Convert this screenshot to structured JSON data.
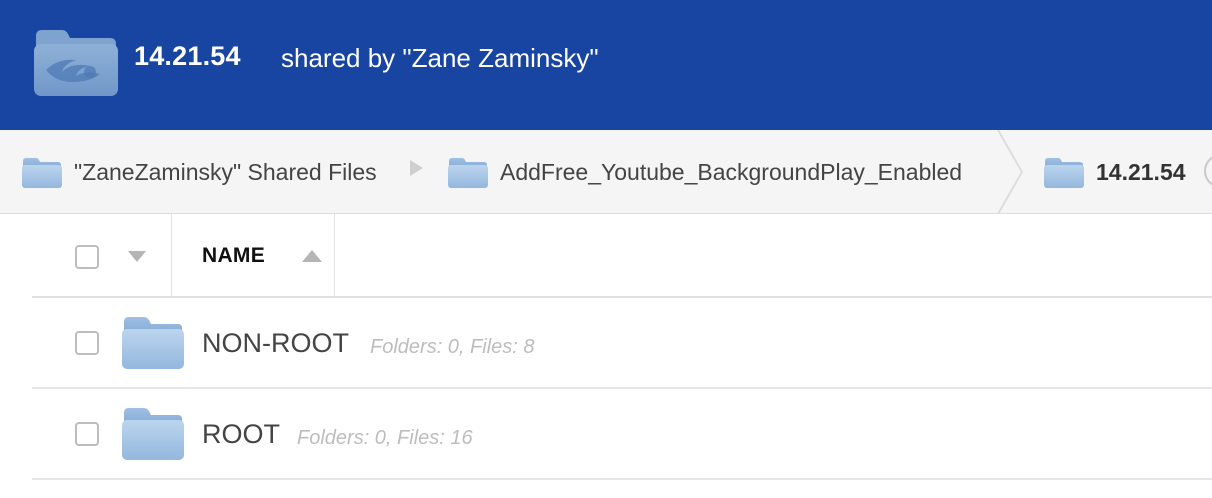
{
  "header": {
    "title": "14.21.54",
    "subtitle": "shared by \"Zane Zaminsky\"",
    "icon": "shared-folder-logo-icon"
  },
  "breadcrumbs": [
    {
      "label": "\"ZaneZaminsky\" Shared Files",
      "icon": "folder-icon"
    },
    {
      "label": "AddFree_Youtube_BackgroundPlay_Enabled",
      "icon": "folder-icon"
    },
    {
      "label": "14.21.54",
      "icon": "folder-icon",
      "current": true
    }
  ],
  "table": {
    "columns": [
      {
        "label": "NAME",
        "sort": "ascending"
      }
    ],
    "rows": [
      {
        "name": "NON-ROOT",
        "meta": "Folders: 0, Files: 8",
        "icon": "folder-icon"
      },
      {
        "name": "ROOT",
        "meta": "Folders: 0, Files: 16",
        "icon": "folder-icon"
      }
    ]
  },
  "colors": {
    "header_bg": "#1745a1",
    "breadcrumb_bg": "#f5f5f5",
    "folder_blue": "#a9c7e6",
    "meta_text": "#bdbdbd"
  }
}
